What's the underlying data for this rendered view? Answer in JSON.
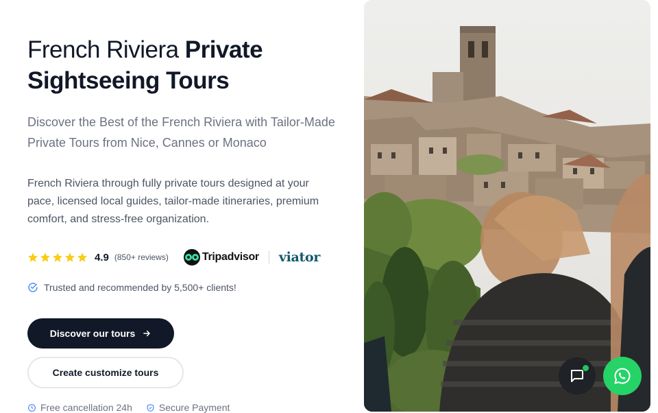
{
  "hero": {
    "title_regular": "French Riviera ",
    "title_bold": "Private Sightseeing Tours",
    "subtitle": "Discover the Best of the French Riviera with Tailor-Made Private Tours from Nice, Cannes or Monaco",
    "body": "French Riviera through fully private tours designed at your pace, licensed local guides, tailor-made itineraries, premium comfort, and stress-free organization."
  },
  "rating": {
    "stars": 5,
    "score": "4.9",
    "reviews": "(850+ reviews)",
    "star_color": "#facc15",
    "tripadvisor_label": "Tripadvisor",
    "viator_label": "viator"
  },
  "trusted": {
    "text": "Trusted and recommended by 5,500+ clients!",
    "icon": "check-circle-icon"
  },
  "cta": {
    "primary_label": "Discover our tours",
    "secondary_label": "Create customize tours"
  },
  "features": [
    {
      "label": "Free cancellation 24h",
      "icon": "clock-icon"
    },
    {
      "label": "Secure Payment",
      "icon": "shield-check-icon"
    }
  ],
  "image": {
    "subject": "hilltop village photo with tourists"
  },
  "floating": {
    "chat_icon": "chat-icon",
    "whatsapp_icon": "whatsapp-icon",
    "whatsapp_color": "#25d366"
  }
}
